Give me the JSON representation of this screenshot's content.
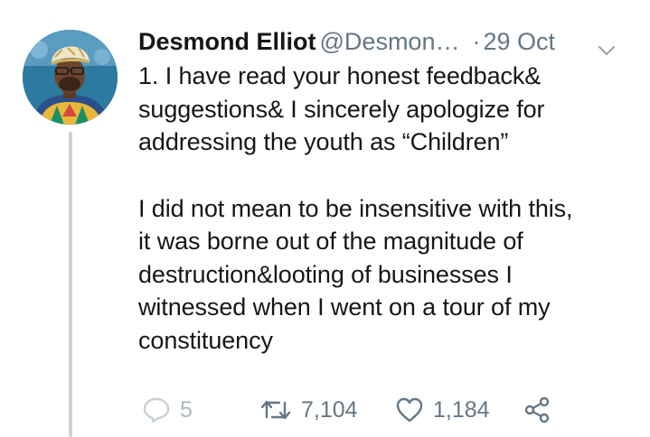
{
  "tweet": {
    "author": {
      "display_name": "Desmond Elliot",
      "handle": "@Desmon…",
      "avatar_icon": "profile-photo"
    },
    "separator": "·",
    "date": "29 Oct",
    "menu_icon": "chevron-down-icon",
    "paragraph_1_lines": [
      "1. I have read your honest feedback&",
      "suggestions& I sincerely apologize for",
      "addressing the youth as “Children”"
    ],
    "paragraph_2_lines": [
      "I did not mean to be insensitive with this,",
      "it was borne out of the magnitude of",
      "destruction&looting of businesses I",
      "witnessed when I went on a tour of my",
      "constituency"
    ],
    "actions": {
      "reply": {
        "icon": "reply-icon",
        "count": "5"
      },
      "retweet": {
        "icon": "retweet-icon",
        "count": "7,104"
      },
      "like": {
        "icon": "heart-icon",
        "count": "1,184"
      },
      "share": {
        "icon": "share-icon"
      }
    }
  },
  "colors": {
    "text_primary": "#14171a",
    "text_secondary": "#657786",
    "thread_line": "#c9d1d9",
    "reply_icon": "#c8d1d9"
  }
}
